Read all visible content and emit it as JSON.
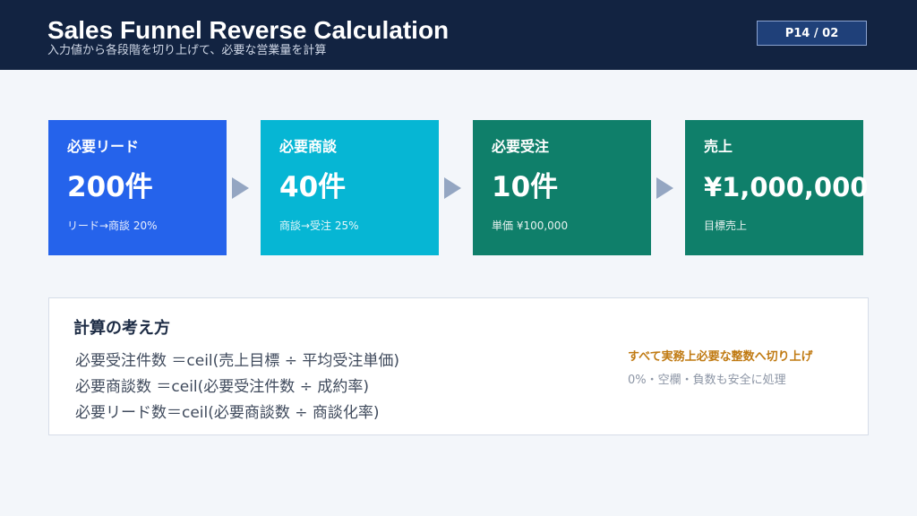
{
  "header": {
    "title": "Sales Funnel Reverse Calculation",
    "subtitle": "入力値から各段階を切り上げて、必要な営業量を計算",
    "page_indicator": "P14 / 02",
    "background_color": "#122341"
  },
  "funnel": {
    "cards": [
      {
        "label": "必要リード",
        "value": "200件",
        "note": "リード→商談 20%",
        "color": "#2563eb"
      },
      {
        "label": "必要商談",
        "value": "40件",
        "note": "商談→受注 25%",
        "color": "#06b6d4"
      },
      {
        "label": "必要受注",
        "value": "10件",
        "note": "単価 ¥100,000",
        "color": "#0f7f6a"
      },
      {
        "label": "売上",
        "value": "¥1,000,000",
        "note": "目標売上",
        "color": "#0f7f6a"
      }
    ],
    "arrow_icon": "triangle-right-icon"
  },
  "explanation": {
    "title": "計算の考え方",
    "formulas": [
      "必要受注件数 ＝ceil(売上目標 ÷ 平均受注単価)",
      "必要商談数 ＝ceil(必要受注件数 ÷ 成約率)",
      "必要リード数＝ceil(必要商談数 ÷ 商談化率)"
    ],
    "highlight_note": "すべて実務上必要な整数へ切り上げ",
    "sub_note": "0%・空欄・負数も安全に処理",
    "highlight_color": "#c07a12"
  }
}
